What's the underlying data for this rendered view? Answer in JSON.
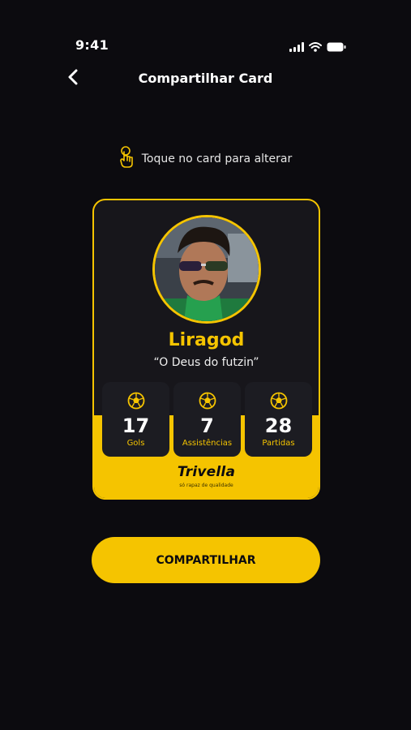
{
  "status_bar": {
    "time": "9:41"
  },
  "header": {
    "title": "Compartilhar Card"
  },
  "hint": {
    "text": "Toque no card para alterar",
    "icon": "tap-icon"
  },
  "card": {
    "player_name": "Liragod",
    "nickname": "“O Deus do futzin”",
    "stats": [
      {
        "value": "17",
        "label": "Gols"
      },
      {
        "value": "7",
        "label": "Assistências"
      },
      {
        "value": "28",
        "label": "Partidas"
      }
    ],
    "brand": "Trivella",
    "brand_tagline": "só rapaz de qualidade"
  },
  "actions": {
    "share_label": "COMPARTILHAR"
  },
  "colors": {
    "accent": "#f5c400",
    "background": "#0c0b0f",
    "card": "#17161b",
    "stat_bg": "#1c1c22"
  }
}
